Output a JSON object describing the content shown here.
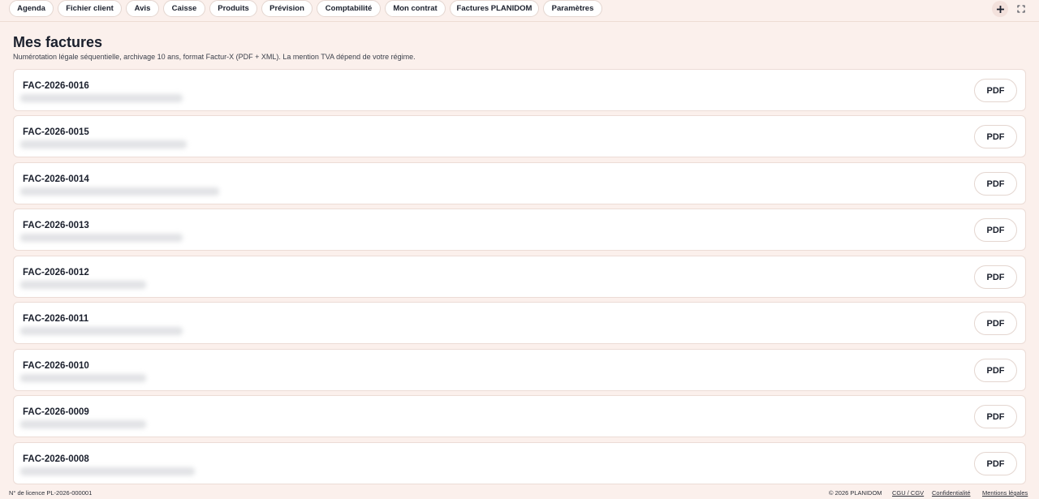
{
  "nav": {
    "tabs": [
      {
        "label": "Agenda"
      },
      {
        "label": "Fichier client"
      },
      {
        "label": "Avis"
      },
      {
        "label": "Caisse"
      },
      {
        "label": "Produits"
      },
      {
        "label": "Prévision"
      },
      {
        "label": "Comptabilité"
      },
      {
        "label": "Mon contrat"
      },
      {
        "label": "Factures PLANIDOM"
      },
      {
        "label": "Paramètres"
      }
    ],
    "icons": {
      "add": "plus-icon",
      "fullscreen": "expand-icon"
    }
  },
  "page": {
    "title": "Mes factures",
    "subtitle": "Numérotation légale séquentielle, archivage 10 ans, format Factur-X (PDF + XML). La mention TVA dépend de votre régime."
  },
  "invoices": [
    {
      "number": "FAC-2026-0016",
      "pdf_label": "PDF"
    },
    {
      "number": "FAC-2026-0015",
      "pdf_label": "PDF"
    },
    {
      "number": "FAC-2026-0014",
      "pdf_label": "PDF"
    },
    {
      "number": "FAC-2026-0013",
      "pdf_label": "PDF"
    },
    {
      "number": "FAC-2026-0012",
      "pdf_label": "PDF"
    },
    {
      "number": "FAC-2026-0011",
      "pdf_label": "PDF"
    },
    {
      "number": "FAC-2026-0010",
      "pdf_label": "PDF"
    },
    {
      "number": "FAC-2026-0009",
      "pdf_label": "PDF"
    },
    {
      "number": "FAC-2026-0008",
      "pdf_label": "PDF"
    }
  ],
  "footer": {
    "license": "N° de licence PL-2026-000001",
    "copyright": "© 2026 PLANIDOM",
    "links": [
      {
        "label": "CGU / CGV"
      },
      {
        "label": "Confidentialité"
      },
      {
        "label": "Mentions légales"
      }
    ]
  },
  "colors": {
    "background": "#fbf0ec",
    "card": "#ffffff",
    "text": "#1a1f2c",
    "accent_circle": "#f3e1dc"
  }
}
